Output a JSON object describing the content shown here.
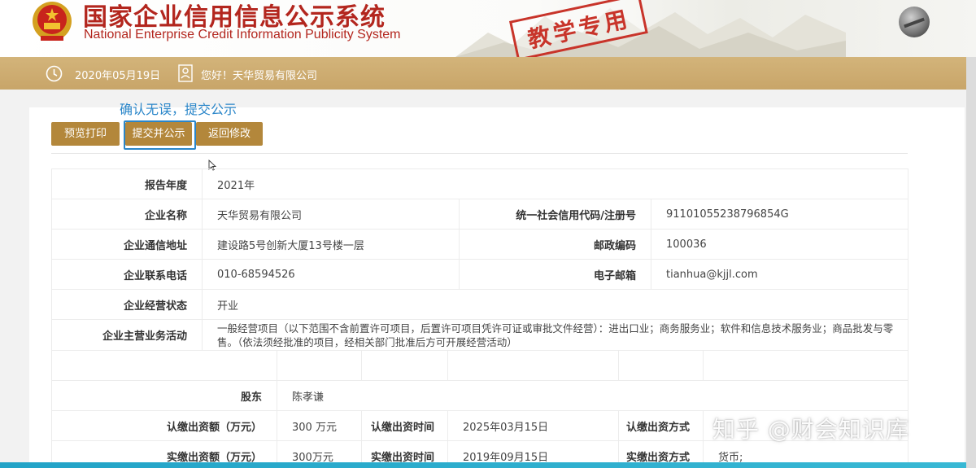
{
  "header": {
    "title_cn": "国家企业信用信息公示系统",
    "title_en": "National Enterprise Credit Information Publicity System",
    "stamp": "教学专用",
    "emblem_icon": "national-emblem-icon",
    "brand_color": "#b3261e"
  },
  "topbar": {
    "date": "2020年05月19日",
    "greeting": "您好！天华贸易有限公司",
    "bar_color": "#c8a569"
  },
  "hint": "确认无误，提交公示",
  "buttons": {
    "preview": "预览打印",
    "submit": "提交并公示",
    "back": "返回修改",
    "button_color": "#b3873b"
  },
  "report": {
    "year_label": "报告年度",
    "year_value": "2021年",
    "name_label": "企业名称",
    "name_value": "天华贸易有限公司",
    "credit_code_label": "统一社会信用代码/注册号",
    "credit_code_value": "91101055238796854G",
    "address_label": "企业通信地址",
    "address_value": "建设路5号创新大厦13号楼一层",
    "postcode_label": "邮政编码",
    "postcode_value": "100036",
    "phone_label": "企业联系电话",
    "phone_value": "010-68594526",
    "email_label": "电子邮箱",
    "email_value": "tianhua@kjjl.com",
    "status_label": "企业经营状态",
    "status_value": "开业",
    "business_label": "企业主营业务活动",
    "business_value": "一般经营项目（以下范围不含前置许可项目，后置许可项目凭许可证或审批文件经营）：进出口业；商务服务业；软件和信息技术服务业；商品批发与零售。（依法须经批准的项目，经相关部门批准后方可开展经营活动）"
  },
  "shareholder": {
    "label": "股东",
    "name": "陈孝谦",
    "subscribed_amount_label": "认缴出资额（万元）",
    "subscribed_amount_value": "300 万元",
    "subscribed_time_label": "认缴出资时间",
    "subscribed_time_value": "2025年03月15日",
    "subscribed_method_label": "认缴出资方式",
    "paid_amount_label": "实缴出资额（万元）",
    "paid_amount_value": "300万元",
    "paid_time_label": "实缴出资时间",
    "paid_time_value": "2019年09月15日",
    "paid_method_label": "实缴出资方式",
    "paid_method_value": "货币;"
  },
  "watermark": "知乎 @财会知识库"
}
